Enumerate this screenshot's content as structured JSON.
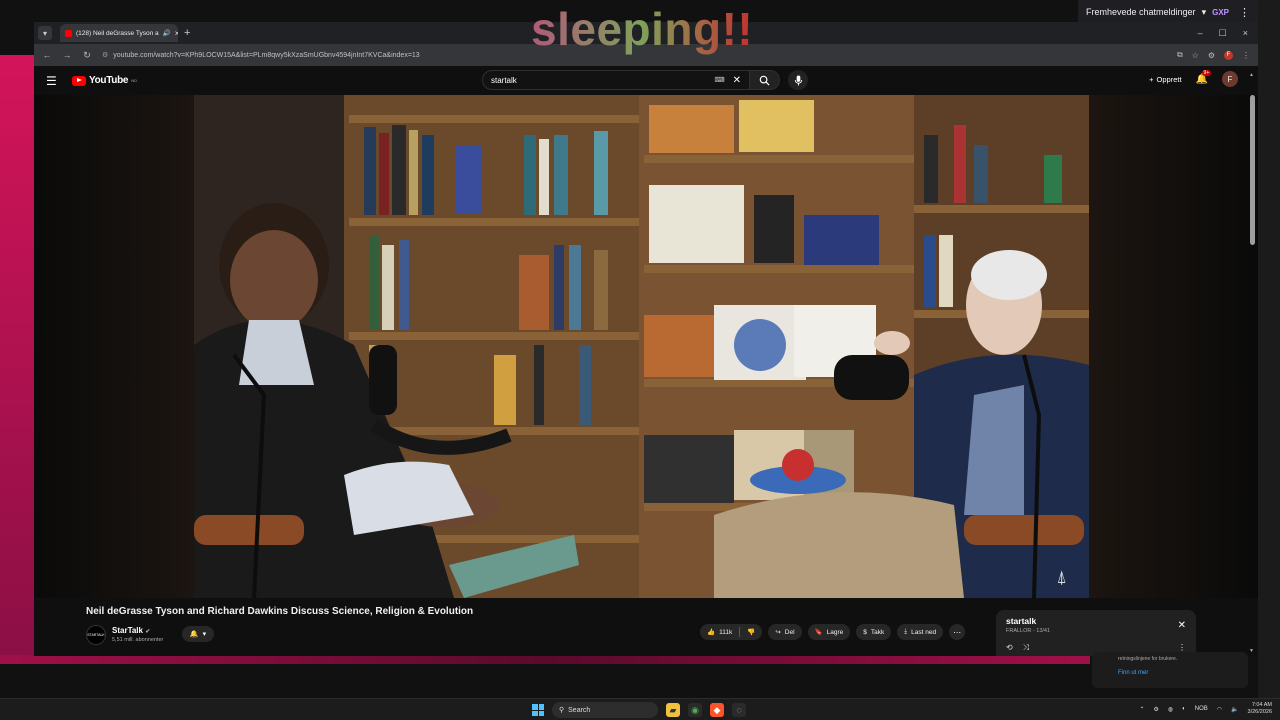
{
  "overlay": {
    "title": "sleeping!!"
  },
  "chat_bar": {
    "label": "Fremhevede chatmeldinger",
    "badge": "GXP",
    "caret": "▾",
    "menu": "⋮"
  },
  "browser": {
    "tab_title": "(128) Neil deGrasse Tyson a",
    "tab_audio": "🔊",
    "tab_close": "×",
    "new_tab": "+",
    "url": "youtube.com/watch?v=KPh9LOCW15A&list=PLm8qwy5kXzaSmUGbnv4594jnInt7KVCa&index=13",
    "window_controls": [
      "–",
      "☐",
      "×"
    ],
    "profile_initial": "F"
  },
  "youtube": {
    "logo_text": "YouTube",
    "region": "NO",
    "search_value": "startalk",
    "keyboard_icon": "⌨",
    "clear_icon": "✕",
    "create_label": "Opprett",
    "notification_count": "9+",
    "avatar_initial": "F"
  },
  "video": {
    "title": "Neil deGrasse Tyson and Richard Dawkins Discuss Science, Religion & Evolution",
    "watermark": "⍋"
  },
  "channel": {
    "logo_text": "STARTALK",
    "name": "StarTalk",
    "verified": "✔",
    "subscribers": "5,51 mill. abonnenter"
  },
  "actions": {
    "likes": "111k",
    "share": "Del",
    "save": "Lagre",
    "thanks": "Takk",
    "download": "Last ned",
    "more": "⋯"
  },
  "playlist": {
    "title": "startalk",
    "subtitle": "FRALLOR - 13/41",
    "close": "✕",
    "menu": "⋮"
  },
  "popup": {
    "text": "retningslinjene for brukere.",
    "link": "Finn ut mer"
  },
  "taskbar": {
    "search": "Search",
    "lang": "NOB",
    "time": "7:04 AM",
    "date": "3/26/2026"
  },
  "colors": {
    "accent": "#ff0000",
    "link": "#3ea6ff"
  }
}
